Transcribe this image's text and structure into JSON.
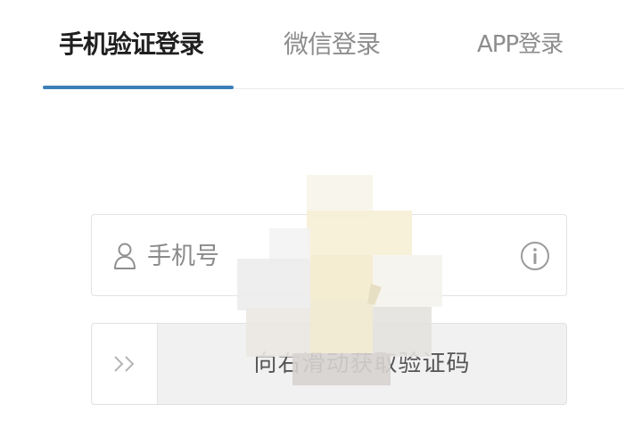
{
  "tabs": [
    {
      "label": "手机验证登录",
      "active": true
    },
    {
      "label": "微信登录",
      "active": false
    },
    {
      "label": "APP登录",
      "active": false
    }
  ],
  "phone": {
    "placeholder": "手机号",
    "icon": "user-icon",
    "trailing_icon": "info-icon"
  },
  "slider": {
    "handle_icon": "double-chevron-right-icon",
    "label": "向右滑动获取验证码"
  },
  "colors": {
    "accent": "#3c7fb8",
    "text_active": "#1f1f1f",
    "text_inactive": "#8d8d8d",
    "border": "#e3e3e3",
    "slider_bg": "#f1f1f1"
  }
}
